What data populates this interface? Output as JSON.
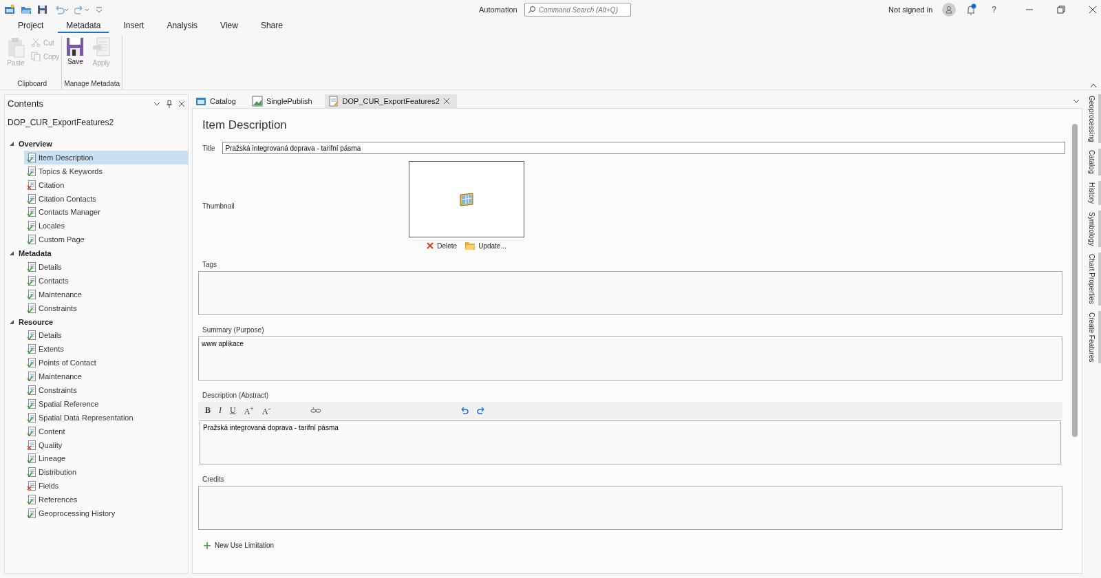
{
  "title_bar": {
    "automation": "Automation",
    "search": {
      "placeholder": "Command Search (Alt+Q)"
    },
    "sign_in": "Not signed in",
    "help": "?"
  },
  "ribbon": {
    "tabs": [
      {
        "label": "Project",
        "selected": false
      },
      {
        "label": "Metadata",
        "selected": true
      },
      {
        "label": "Insert",
        "selected": false
      },
      {
        "label": "Analysis",
        "selected": false
      },
      {
        "label": "View",
        "selected": false
      },
      {
        "label": "Share",
        "selected": false
      }
    ],
    "groups": [
      {
        "label": "Clipboard",
        "buttons": [
          {
            "kind": "paste",
            "label": "Paste",
            "disabled": true
          },
          {
            "kind": "cut",
            "label": "Cut",
            "disabled": true
          },
          {
            "kind": "copy",
            "label": "Copy",
            "disabled": true
          }
        ]
      },
      {
        "label": "Manage Metadata",
        "buttons": [
          {
            "kind": "save",
            "label": "Save",
            "disabled": false
          },
          {
            "kind": "apply",
            "label": "Apply",
            "disabled": true
          }
        ]
      }
    ]
  },
  "contents": {
    "title": "Contents",
    "item": "DOP_CUR_ExportFeatures2",
    "sections": [
      {
        "label": "Overview",
        "expanded": true,
        "children": [
          {
            "label": "Item Description",
            "valid": true,
            "selected": true
          },
          {
            "label": "Topics & Keywords",
            "valid": true,
            "selected": false
          },
          {
            "label": "Citation",
            "valid": false,
            "selected": false
          },
          {
            "label": "Citation Contacts",
            "valid": true,
            "selected": false
          },
          {
            "label": "Contacts Manager",
            "valid": true,
            "selected": false
          },
          {
            "label": "Locales",
            "valid": true,
            "selected": false
          },
          {
            "label": "Custom Page",
            "valid": true,
            "selected": false
          }
        ]
      },
      {
        "label": "Metadata",
        "expanded": true,
        "children": [
          {
            "label": "Details",
            "valid": true,
            "selected": false
          },
          {
            "label": "Contacts",
            "valid": true,
            "selected": false
          },
          {
            "label": "Maintenance",
            "valid": true,
            "selected": false
          },
          {
            "label": "Constraints",
            "valid": true,
            "selected": false
          }
        ]
      },
      {
        "label": "Resource",
        "expanded": true,
        "children": [
          {
            "label": "Details",
            "valid": true,
            "selected": false
          },
          {
            "label": "Extents",
            "valid": true,
            "selected": false
          },
          {
            "label": "Points of Contact",
            "valid": true,
            "selected": false
          },
          {
            "label": "Maintenance",
            "valid": true,
            "selected": false
          },
          {
            "label": "Constraints",
            "valid": true,
            "selected": false
          },
          {
            "label": "Spatial Reference",
            "valid": true,
            "selected": false
          },
          {
            "label": "Spatial Data Representation",
            "valid": true,
            "selected": false
          },
          {
            "label": "Content",
            "valid": true,
            "selected": false
          },
          {
            "label": "Quality",
            "valid": false,
            "selected": false
          },
          {
            "label": "Lineage",
            "valid": true,
            "selected": false
          },
          {
            "label": "Distribution",
            "valid": true,
            "selected": false
          },
          {
            "label": "Fields",
            "valid": false,
            "selected": false
          },
          {
            "label": "References",
            "valid": true,
            "selected": false
          },
          {
            "label": "Geoprocessing History",
            "valid": true,
            "selected": false
          }
        ]
      }
    ]
  },
  "doc_tabs": [
    {
      "kind": "catalog",
      "label": "Catalog",
      "selected": false
    },
    {
      "kind": "map",
      "label": "SinglePublish",
      "selected": false
    },
    {
      "kind": "metadata",
      "label": "DOP_CUR_ExportFeatures2",
      "selected": true
    }
  ],
  "item_description": {
    "heading": "Item Description",
    "title_label": "Title",
    "title_value": "Pražská integrovaná doprava - tarifní pásma",
    "thumbnail_label": "Thumbnail",
    "delete": "Delete",
    "update": "Update...",
    "tags_label": "Tags",
    "summary_label": "Summary (Purpose)",
    "summary_value": "www aplikace",
    "description_label": "Description (Abstract)",
    "format_buttons": [
      {
        "kind": "bold",
        "label": "B"
      },
      {
        "kind": "italic",
        "label": "I"
      },
      {
        "kind": "underline",
        "label": "U"
      },
      {
        "kind": "grow",
        "label": "A$^{+}$"
      },
      {
        "kind": "shrink",
        "label": "A$^{-}$"
      }
    ],
    "description_value": "Pražská integrovaná doprava - tarifní pásma",
    "credits_label": "Credits",
    "new_use_limitation": "New Use Limitation"
  },
  "side_tabs": [
    "Geoprocessing",
    "Catalog",
    "History",
    "Symbology",
    "Chart Properties",
    "Create Features"
  ]
}
